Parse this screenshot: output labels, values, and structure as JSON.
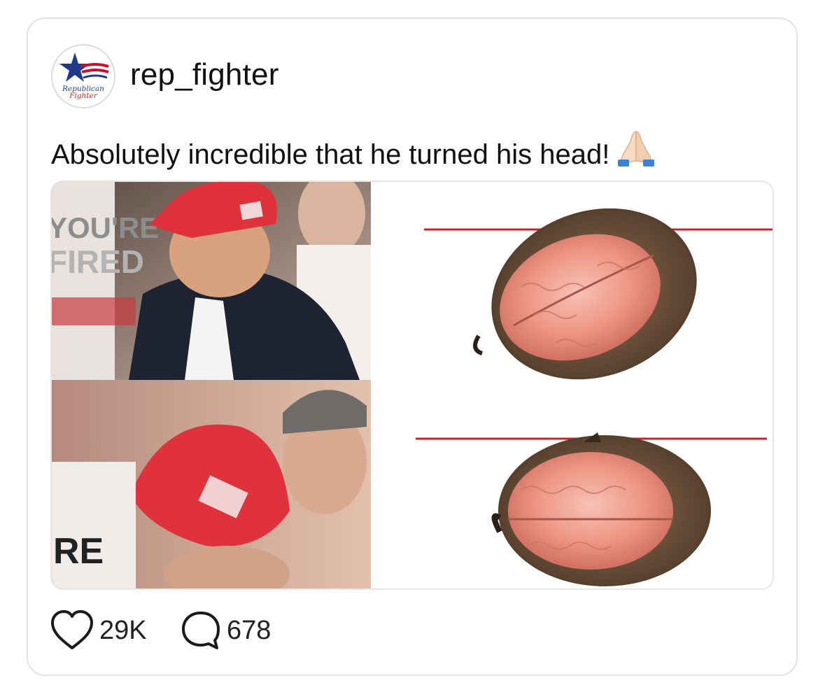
{
  "post": {
    "author": {
      "username": "rep_fighter",
      "avatar_text_line1": "Republican",
      "avatar_text_line2": "Fighter",
      "avatar_icon": "star-flag-logo"
    },
    "caption": "Absolutely incredible that he turned his head!",
    "caption_emoji": "folded-hands-emoji",
    "media": {
      "type": "image",
      "sign_text_top_line1": "YOU'RE",
      "sign_text_top_line2": "FIRED",
      "sign_text_bottom": "RE"
    },
    "stats": {
      "likes": "29K",
      "comments": "678",
      "like_icon": "heart-icon",
      "comment_icon": "speech-bubble-icon"
    }
  },
  "colors": {
    "brand_blue": "#1f3a8a",
    "brand_red": "#c8102e",
    "card_border": "#e2e2e2",
    "hat_red": "#e0323c",
    "red_line": "#c0262c"
  }
}
